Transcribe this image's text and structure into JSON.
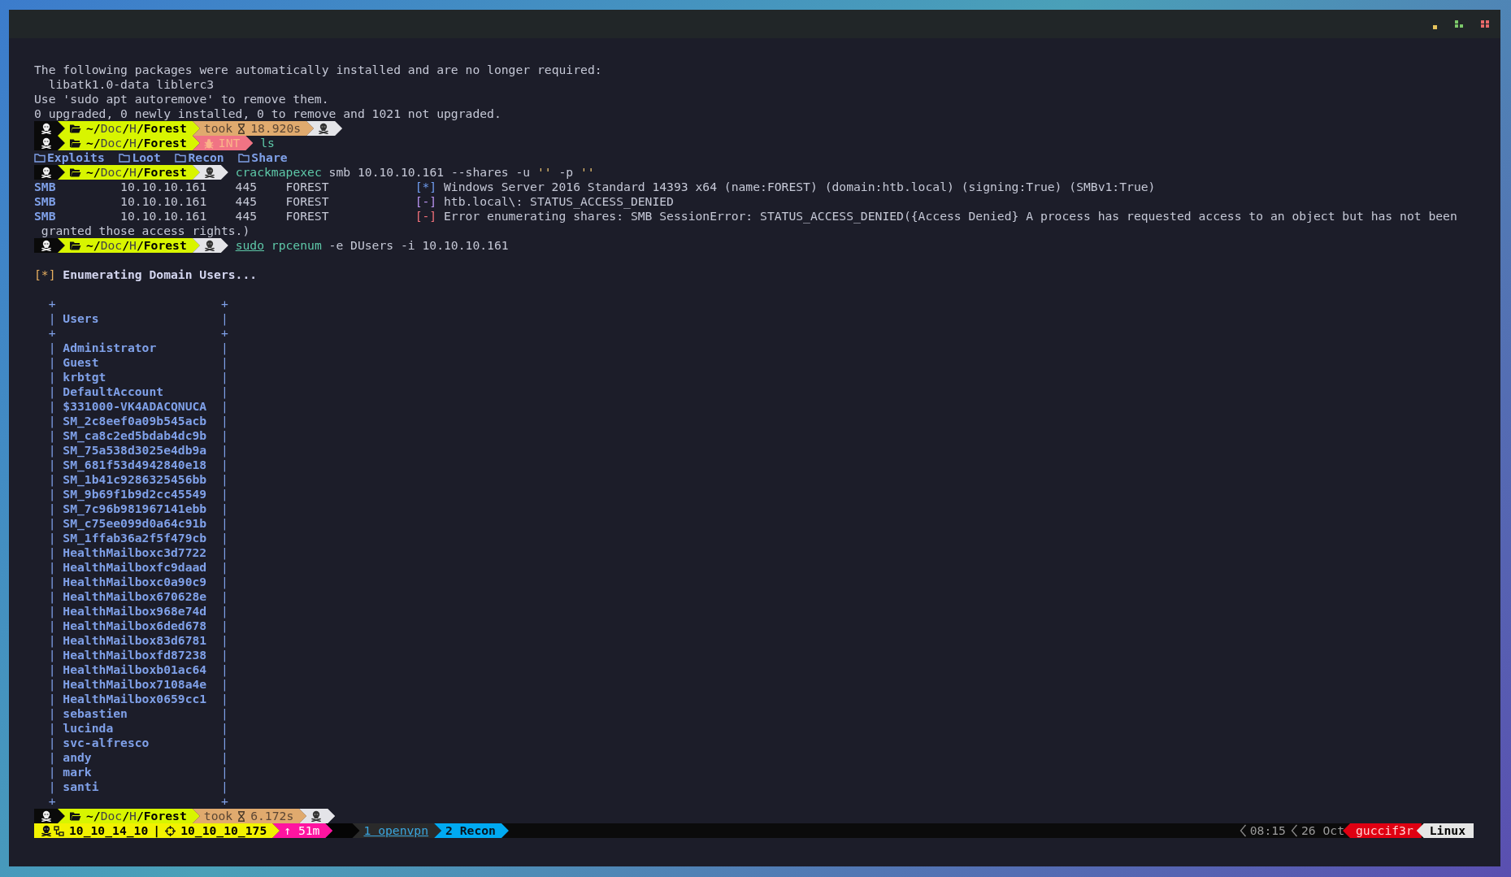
{
  "terminal": {
    "lines": [
      {
        "kind": "text",
        "text": "The following packages were automatically installed and are no longer required:"
      },
      {
        "kind": "text",
        "text": "  libatk1.0-data liblerc3"
      },
      {
        "kind": "text",
        "text": "Use 'sudo apt autoremove' to remove them."
      },
      {
        "kind": "text",
        "text": "0 upgraded, 0 newly installed, 0 to remove and 1021 not upgraded."
      },
      {
        "kind": "prompt",
        "segments": [
          {
            "kind": "user"
          },
          {
            "kind": "path",
            "text": "**~/**Doc**/**H**/Forest**"
          },
          {
            "kind": "took",
            "label": "took",
            "value": "18.920s"
          },
          {
            "kind": "end"
          }
        ]
      },
      {
        "kind": "prompt",
        "segments": [
          {
            "kind": "user"
          },
          {
            "kind": "path",
            "text": "**~/**Doc**/**H**/Forest**"
          },
          {
            "kind": "error",
            "label": "INT"
          }
        ],
        "command": [
          {
            "kind": "program",
            "text": "ls"
          }
        ]
      },
      {
        "kind": "listing",
        "items": [
          "Exploits",
          "Loot",
          "Recon",
          "Share"
        ]
      },
      {
        "kind": "prompt",
        "segments": [
          {
            "kind": "user"
          },
          {
            "kind": "path",
            "text": "**~/**Doc**/**H**/Forest**"
          },
          {
            "kind": "end"
          }
        ],
        "command": [
          {
            "kind": "program",
            "text": "crackmapexec"
          },
          {
            "kind": "arg",
            "text": "smb"
          },
          {
            "kind": "arg",
            "text": "10.10.10.161"
          },
          {
            "kind": "arg",
            "text": "--shares"
          },
          {
            "kind": "arg",
            "text": "-u"
          },
          {
            "kind": "string",
            "text": "''"
          },
          {
            "kind": "arg",
            "text": "-p"
          },
          {
            "kind": "string",
            "text": "''"
          }
        ]
      },
      {
        "kind": "smb",
        "protocol": "SMB",
        "ip": "10.10.10.161",
        "port": "445",
        "host": "FOREST",
        "mark": "[*]",
        "color": "#6f9cf0",
        "message": "Windows Server 2016 Standard 14393 x64 (name:FOREST) (domain:htb.local) (signing:True) (SMBv1:True)"
      },
      {
        "kind": "smb",
        "protocol": "SMB",
        "ip": "10.10.10.161",
        "port": "445",
        "host": "FOREST",
        "mark": "[-]",
        "color": "#b893f0",
        "message": "htb.local\\: STATUS_ACCESS_DENIED"
      },
      {
        "kind": "smb",
        "protocol": "SMB",
        "ip": "10.10.10.161",
        "port": "445",
        "host": "FOREST",
        "mark": "[-]",
        "color": "#f0707a",
        "message": "Error enumerating shares: SMB SessionError: STATUS_ACCESS_DENIED({Access Denied} A process has requested access to an object but has not been"
      },
      {
        "kind": "continuation",
        "text": "granted those access rights.)"
      },
      {
        "kind": "prompt",
        "segments": [
          {
            "kind": "user"
          },
          {
            "kind": "path",
            "text": "**~/**Doc**/**H**/Forest**"
          },
          {
            "kind": "end"
          }
        ],
        "command": [
          {
            "kind": "sudo",
            "text": "sudo"
          },
          {
            "kind": "program",
            "text": "rpcenum"
          },
          {
            "kind": "arg",
            "text": "-e"
          },
          {
            "kind": "arg",
            "text": "DUsers"
          },
          {
            "kind": "arg",
            "text": "-i"
          },
          {
            "kind": "arg",
            "text": "10.10.10.161"
          }
        ]
      },
      {
        "kind": "blank"
      },
      {
        "kind": "info",
        "mark": "[*]",
        "text": "Enumerating Domain Users..."
      },
      {
        "kind": "blank"
      },
      {
        "kind": "table",
        "corner": "+",
        "edge": "|",
        "header": "Users",
        "rows": [
          "Administrator",
          "Guest",
          "krbtgt",
          "DefaultAccount",
          "$331000-VK4ADACQNUCA",
          "SM_2c8eef0a09b545acb",
          "SM_ca8c2ed5bdab4dc9b",
          "SM_75a538d3025e4db9a",
          "SM_681f53d4942840e18",
          "SM_1b41c9286325456bb",
          "SM_9b69f1b9d2cc45549",
          "SM_7c96b981967141ebb",
          "SM_c75ee099d0a64c91b",
          "SM_1ffab36a2f5f479cb",
          "HealthMailboxc3d7722",
          "HealthMailboxfc9daad",
          "HealthMailboxc0a90c9",
          "HealthMailbox670628e",
          "HealthMailbox968e74d",
          "HealthMailbox6ded678",
          "HealthMailbox83d6781",
          "HealthMailboxfd87238",
          "HealthMailboxb01ac64",
          "HealthMailbox7108a4e",
          "HealthMailbox0659cc1",
          "sebastien",
          "lucinda",
          "svc-alfresco",
          "andy",
          "mark",
          "santi"
        ]
      },
      {
        "kind": "prompt",
        "segments": [
          {
            "kind": "user"
          },
          {
            "kind": "path",
            "text": "**~/**Doc**/**H**/Forest**"
          },
          {
            "kind": "took",
            "label": "took",
            "value": "6.172s"
          },
          {
            "kind": "end"
          }
        ]
      }
    ]
  },
  "status_bar": {
    "vpn_ip": "10_10_14_10",
    "separator": "|",
    "target_ip": "10_10_10_175",
    "uptime": "↑ 51m",
    "windows": [
      {
        "index": "1",
        "name": "openvpn",
        "selected": false
      },
      {
        "index": "2",
        "name": "Recon",
        "selected": true
      }
    ],
    "time": "08:15",
    "date": "26 Oct",
    "user": "guccif3r",
    "os": "Linux"
  }
}
